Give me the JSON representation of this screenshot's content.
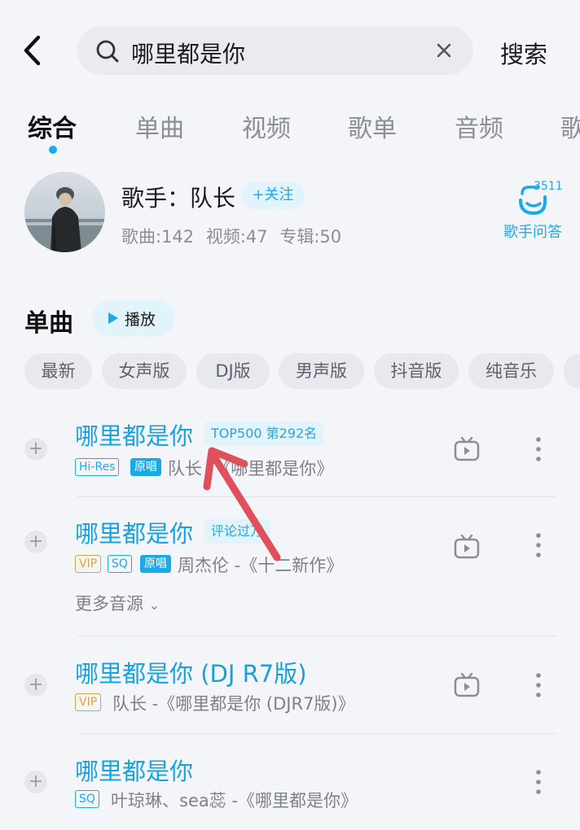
{
  "search": {
    "query": "哪里都是你",
    "button_label": "搜索"
  },
  "tabs": [
    {
      "label": "综合",
      "active": true
    },
    {
      "label": "单曲",
      "active": false
    },
    {
      "label": "视频",
      "active": false
    },
    {
      "label": "歌单",
      "active": false
    },
    {
      "label": "音频",
      "active": false
    },
    {
      "label": "歌",
      "active": false
    }
  ],
  "singer": {
    "name_line": "歌手：队长",
    "follow_label": "+关注",
    "stats": [
      "歌曲:142",
      "视频:47",
      "专辑:50"
    ],
    "qa_count": "3511",
    "qa_label": "歌手问答"
  },
  "singles": {
    "title": "单曲",
    "play_label": "播放",
    "filters": [
      "最新",
      "女声版",
      "DJ版",
      "男声版",
      "抖音版",
      "纯音乐"
    ]
  },
  "songs": [
    {
      "title": "哪里都是你",
      "badge": "TOP500 第292名",
      "tags": [
        "Hi-Res",
        "原唱"
      ],
      "subtitle": "队长 -《哪里都是你》"
    },
    {
      "title": "哪里都是你",
      "badge": "评论过万",
      "tags": [
        "VIP",
        "SQ",
        "原唱"
      ],
      "subtitle": "周杰伦 -《十二新作》",
      "more_sources": "更多音源"
    },
    {
      "title": "哪里都是你",
      "title_suffix": " (DJ R7版)",
      "tags": [
        "VIP"
      ],
      "subtitle": "队长 -《哪里都是你 (DJR7版)》"
    },
    {
      "title": "哪里都是你",
      "tags": [
        "SQ"
      ],
      "subtitle": "叶琼琳、sea蕊 -《哪里都是你》"
    }
  ],
  "colors": {
    "accent": "#19aae8",
    "annotation_arrow": "#e0505a",
    "vip": "#d9a440"
  }
}
